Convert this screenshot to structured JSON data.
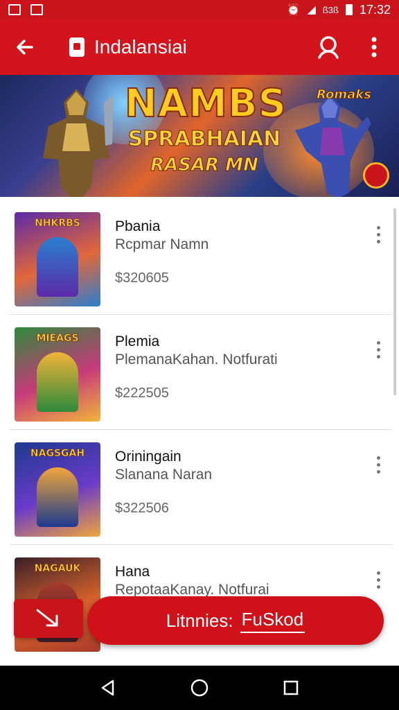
{
  "status_bar": {
    "time": "17:32",
    "network_text": "ß3ß"
  },
  "app_bar": {
    "title": "Indalansiai"
  },
  "banner": {
    "title": "NAMBS",
    "subtitle": "SPRABHAIAN",
    "tagline": "RASAR MN",
    "badge": "Romaks"
  },
  "items": [
    {
      "thumb_label": "NHKRBS",
      "title": "Pbania",
      "subtitle": "Rcpmar Namn",
      "price": "$320605",
      "thumb_colors": [
        "#5b2aa8",
        "#e2673a",
        "#2a7fcf"
      ]
    },
    {
      "thumb_label": "MIEAGS",
      "title": "Plemia",
      "subtitle": "PlemanaKahan. Notfurati",
      "price": "$222505",
      "thumb_colors": [
        "#2d8a3a",
        "#c63a7a",
        "#f2b33a"
      ]
    },
    {
      "thumb_label": "NAGSGAH",
      "title": "Oriningain",
      "subtitle": "Slanana Naran",
      "price": "$322506",
      "thumb_colors": [
        "#1d3a8f",
        "#6a3bc9",
        "#f0a53a"
      ]
    },
    {
      "thumb_label": "NAGAUK",
      "title": "Hana",
      "subtitle": "RepotaaKanay. Notfurai",
      "price": "",
      "thumb_colors": [
        "#3a1f2a",
        "#d4622a",
        "#a83a2a"
      ]
    }
  ],
  "cta": {
    "label": "Litnnies:",
    "value": "FuSkod"
  },
  "colors": {
    "primary": "#d3141c",
    "status": "#c9141c"
  }
}
